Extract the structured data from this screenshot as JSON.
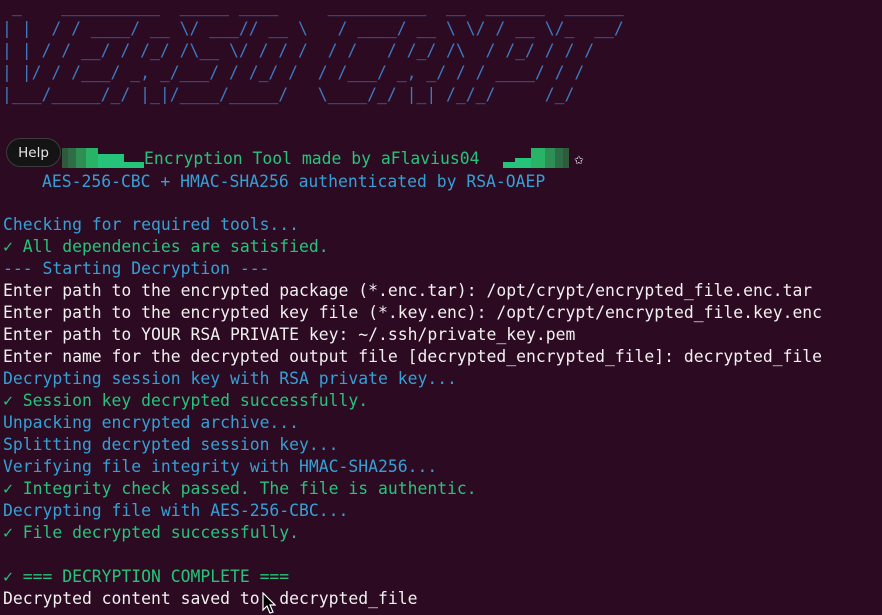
{
  "banner": {
    "ascii_art": " _    __________  _____ ____     __________  __  ______  ______\n| |  / / ____/ __ \\/ ___// __ \\   / ____/ __ \\ \\/ / __ \\/_  __/\n| | / / __/ / /_/ /\\__ \\/ / / /  / /   / /_/ /\\  / /_/ / / /   \n| |/ / /___/ _, _/___/ / /_/ /  / /___/ _, _/ / / ____/ / /    \n|___/_____/_/ |_|/____/_____/   \\____/_/ |_| /_/_/     /_/     "
  },
  "help_button": {
    "label": "Help"
  },
  "tagline": "Encryption Tool made by aFlavius04",
  "star_glyph": "✩",
  "subtitle": "AES-256-CBC + HMAC-SHA256 authenticated by RSA-OAEP",
  "colors": {
    "background": "#2c0a21",
    "banner": "#3e78bf",
    "info": "#35a0d6",
    "success": "#26c47a",
    "text": "#f0f0f0"
  },
  "log": [
    {
      "text": "Checking for required tools...",
      "kind": "info"
    },
    {
      "text": "✓ All dependencies are satisfied.",
      "kind": "ok"
    },
    {
      "text": "--- Starting Decryption ---",
      "kind": "info"
    },
    {
      "text": "Enter path to the encrypted package (*.enc.tar): /opt/crypt/encrypted_file.enc.tar",
      "kind": "text"
    },
    {
      "text": "Enter path to the encrypted key file (*.key.enc): /opt/crypt/encrypted_file.key.enc",
      "kind": "text"
    },
    {
      "text": "Enter path to YOUR RSA PRIVATE key: ~/.ssh/private_key.pem",
      "kind": "text"
    },
    {
      "text": "Enter name for the decrypted output file [decrypted_encrypted_file]: decrypted_file",
      "kind": "text"
    },
    {
      "text": "Decrypting session key with RSA private key...",
      "kind": "info"
    },
    {
      "text": "✓ Session key decrypted successfully.",
      "kind": "ok"
    },
    {
      "text": "Unpacking encrypted archive...",
      "kind": "info"
    },
    {
      "text": "Splitting decrypted session key...",
      "kind": "info"
    },
    {
      "text": "Verifying file integrity with HMAC-SHA256...",
      "kind": "info"
    },
    {
      "text": "✓ Integrity check passed. The file is authentic.",
      "kind": "ok"
    },
    {
      "text": "Decrypting file with AES-256-CBC...",
      "kind": "info"
    },
    {
      "text": "✓ File decrypted successfully.",
      "kind": "ok"
    },
    {
      "text": "",
      "kind": "text"
    },
    {
      "text": "✓ === DECRYPTION COMPLETE ===",
      "kind": "ok"
    },
    {
      "text": "Decrypted content saved to: decrypted_file",
      "kind": "text"
    }
  ]
}
